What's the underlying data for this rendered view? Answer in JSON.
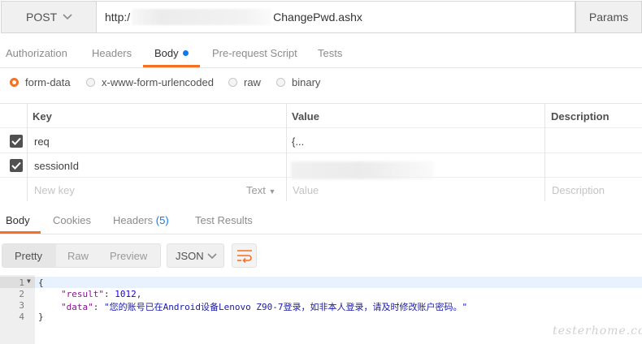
{
  "request": {
    "method": "POST",
    "url_prefix": "http:/",
    "url_suffix": "ChangePwd.ashx",
    "params_label": "Params"
  },
  "request_tabs": [
    {
      "label": "Authorization"
    },
    {
      "label": "Headers"
    },
    {
      "label": "Body"
    },
    {
      "label": "Pre-request Script"
    },
    {
      "label": "Tests"
    }
  ],
  "body_types": [
    {
      "label": "form-data",
      "selected": true
    },
    {
      "label": "x-www-form-urlencoded",
      "selected": false
    },
    {
      "label": "raw",
      "selected": false
    },
    {
      "label": "binary",
      "selected": false
    }
  ],
  "params_table": {
    "headers": {
      "key": "Key",
      "value": "Value",
      "description": "Description"
    },
    "rows": [
      {
        "checked": true,
        "key": "req",
        "value": "{...",
        "description": ""
      },
      {
        "checked": true,
        "key": "sessionId",
        "value": "",
        "description": ""
      }
    ],
    "new_row": {
      "key_placeholder": "New key",
      "type_label": "Text",
      "value_placeholder": "Value",
      "description_placeholder": "Description"
    }
  },
  "response_tabs": {
    "body": "Body",
    "cookies": "Cookies",
    "headers": "Headers",
    "headers_count": "(5)",
    "test_results": "Test Results"
  },
  "response_toolbar": {
    "views": [
      "Pretty",
      "Raw",
      "Preview"
    ],
    "active_view": "Pretty",
    "language": "JSON"
  },
  "response_body": {
    "line_numbers": [
      "1",
      "2",
      "3",
      "4"
    ],
    "open_brace": "{",
    "result_key": "\"result\"",
    "result_value": "1012",
    "data_key": "\"data\"",
    "data_value": "\"您的账号已在Android设备Lenovo Z90-7登录，如非本人登录，请及时修改账户密码。\"",
    "close_brace": "}"
  },
  "watermark": "testerhome.com",
  "colors": {
    "accent": "#f47023",
    "link_blue": "#097bed",
    "json_key": "#881391",
    "json_number": "#1c00cf",
    "json_string": "#1a1aa6"
  }
}
